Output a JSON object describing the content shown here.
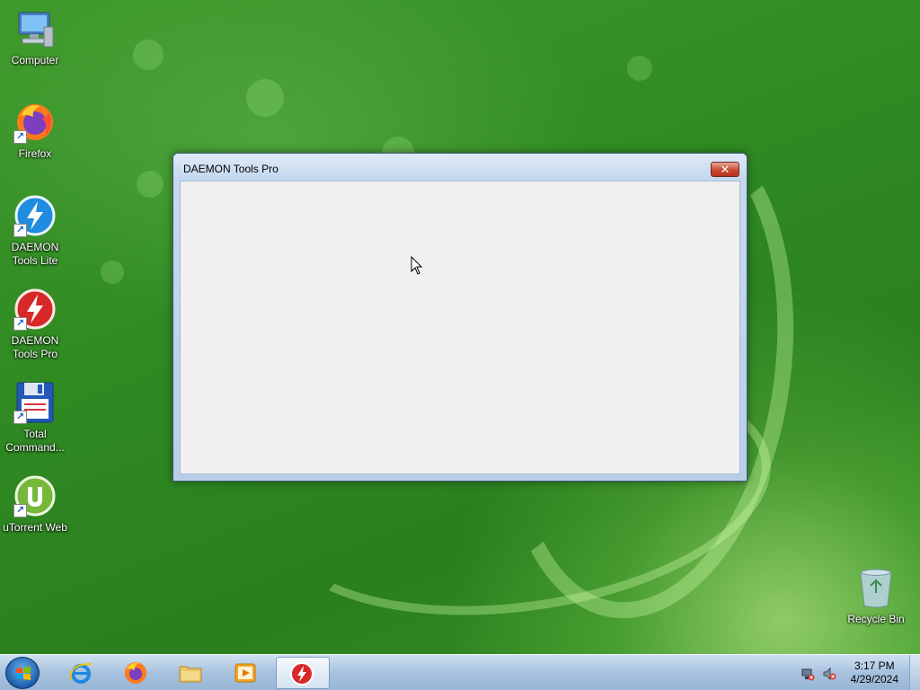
{
  "desktop": {
    "icons": [
      {
        "label": "Computer"
      },
      {
        "label": "Firefox"
      },
      {
        "label": "DAEMON Tools Lite"
      },
      {
        "label": "DAEMON Tools Pro"
      },
      {
        "label": "Total Command..."
      },
      {
        "label": "uTorrent Web"
      }
    ],
    "recycle_bin": {
      "label": "Recycle Bin"
    }
  },
  "window": {
    "title": "DAEMON Tools Pro",
    "close_label": "✕"
  },
  "taskbar": {
    "pinned": [
      {
        "icon": "internet-explorer-icon"
      },
      {
        "icon": "firefox-icon"
      },
      {
        "icon": "file-explorer-icon"
      },
      {
        "icon": "media-player-icon"
      },
      {
        "icon": "daemon-tools-pro-icon",
        "active": true
      }
    ],
    "clock": {
      "time": "3:17 PM",
      "date": "4/29/2024"
    }
  },
  "colors": {
    "accent": "#1b5eaa",
    "daemon_red": "#d7282a",
    "daemon_blue": "#1f8ce0"
  }
}
